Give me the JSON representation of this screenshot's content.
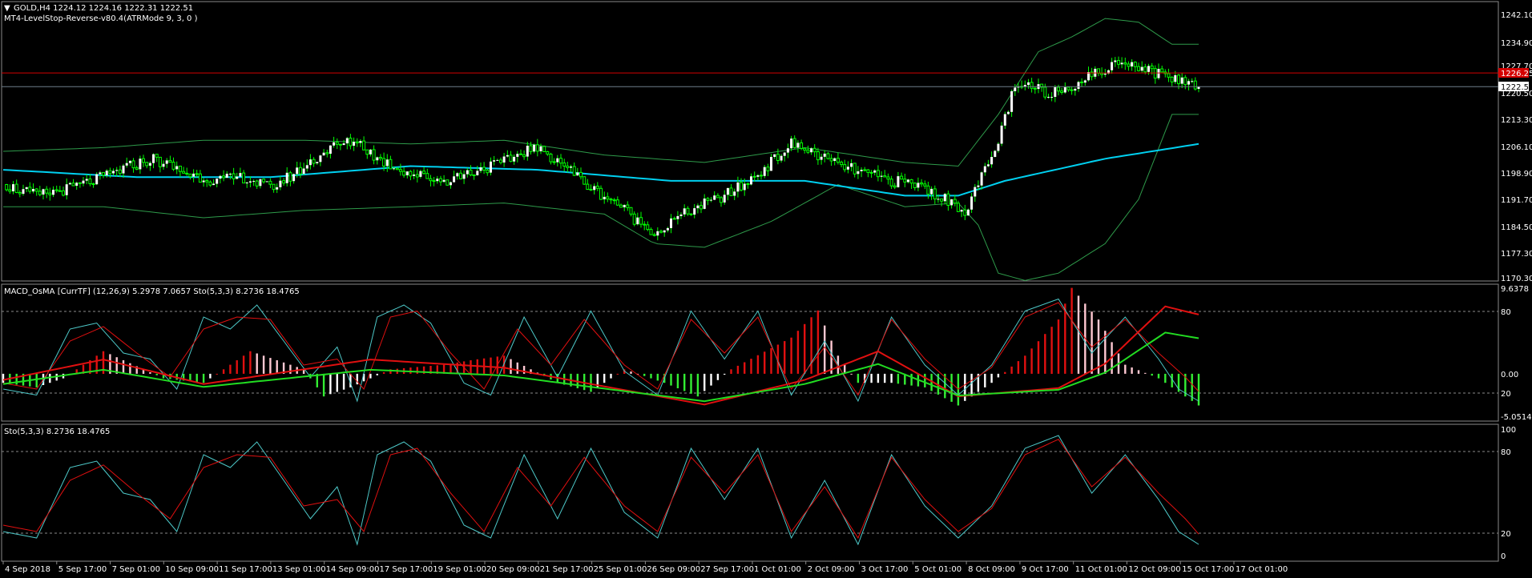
{
  "main_panel": {
    "symbol_line": "GOLD,H4  1224.12 1224.16 1222.31 1222.51",
    "indicator_line": "MT4-LevelStop-Reverse-v80.4(ATRMode 9, 3, 0 )",
    "price_ticks": [
      "1242.10",
      "1234.90",
      "1227.70",
      "1220.50",
      "1213.30",
      "1206.10",
      "1198.90",
      "1191.70",
      "1184.50",
      "1177.30",
      "1170.30"
    ],
    "current_price": "1222.51",
    "stop_level": "1226.25",
    "colors": {
      "bull": "#ffffff",
      "bear": "#000000",
      "wick": "#00ff00",
      "ma": "#00d0f0",
      "bands": "#2e9a4a",
      "stop_line": "#d40000",
      "price_line": "#6e7f8a"
    }
  },
  "macd_panel": {
    "title": "MACD_OsMA [CurrTF] (12,26,9) 5.2978 7.0657   Sto(5,3,3) 8.2736 18.4765",
    "ticks": [
      "9.6378",
      "80",
      "0.00",
      "20",
      "-5.0514"
    ]
  },
  "sto_panel": {
    "title": "Sto(5,3,3) 8.2736 18.4765",
    "ticks": [
      "100",
      "80",
      "20",
      "0"
    ]
  },
  "time_axis": [
    "4 Sep 2018",
    "5 Sep 17:00",
    "7 Sep 01:00",
    "10 Sep 09:00",
    "11 Sep 17:00",
    "13 Sep 01:00",
    "14 Sep 09:00",
    "17 Sep 17:00",
    "19 Sep 01:00",
    "20 Sep 09:00",
    "21 Sep 17:00",
    "25 Sep 01:00",
    "26 Sep 09:00",
    "27 Sep 17:00",
    "1 Oct 01:00",
    "2 Oct 09:00",
    "3 Oct 17:00",
    "5 Oct 01:00",
    "8 Oct 09:00",
    "9 Oct 17:00",
    "11 Oct 01:00",
    "12 Oct 09:00",
    "15 Oct 17:00",
    "17 Oct 01:00"
  ],
  "chart_data": [
    {
      "type": "candlestick",
      "symbol": "GOLD",
      "timeframe": "H4",
      "ylim": [
        1170.3,
        1242.1
      ],
      "close_path": [
        [
          0,
          1196
        ],
        [
          10,
          1193
        ],
        [
          20,
          1195
        ],
        [
          30,
          1198
        ],
        [
          38,
          1201
        ],
        [
          45,
          1203
        ],
        [
          55,
          1199
        ],
        [
          64,
          1197
        ],
        [
          72,
          1198
        ],
        [
          80,
          1195
        ],
        [
          89,
          1200
        ],
        [
          98,
          1206
        ],
        [
          106,
          1208
        ],
        [
          112,
          1203
        ],
        [
          122,
          1199
        ],
        [
          132,
          1197
        ],
        [
          142,
          1200
        ],
        [
          150,
          1202
        ],
        [
          158,
          1206
        ],
        [
          166,
          1203
        ],
        [
          176,
          1195
        ],
        [
          184,
          1191
        ],
        [
          190,
          1186
        ],
        [
          196,
          1183
        ],
        [
          202,
          1187
        ],
        [
          208,
          1190
        ],
        [
          214,
          1192
        ],
        [
          222,
          1196
        ],
        [
          230,
          1202
        ],
        [
          236,
          1207
        ],
        [
          242,
          1205
        ],
        [
          248,
          1202
        ],
        [
          258,
          1199
        ],
        [
          266,
          1197
        ],
        [
          274,
          1196
        ],
        [
          282,
          1192
        ],
        [
          288,
          1189
        ],
        [
          292,
          1196
        ],
        [
          297,
          1205
        ],
        [
          302,
          1220
        ],
        [
          306,
          1223
        ],
        [
          312,
          1221
        ],
        [
          318,
          1222
        ],
        [
          324,
          1225
        ],
        [
          330,
          1227
        ],
        [
          336,
          1230
        ],
        [
          340,
          1228
        ],
        [
          346,
          1226
        ],
        [
          350,
          1225
        ],
        [
          354,
          1224
        ],
        [
          358,
          1222.5
        ]
      ],
      "bands_upper_path": [
        [
          0,
          1205
        ],
        [
          30,
          1206
        ],
        [
          60,
          1208
        ],
        [
          90,
          1208
        ],
        [
          122,
          1207
        ],
        [
          150,
          1208
        ],
        [
          180,
          1204
        ],
        [
          210,
          1202
        ],
        [
          240,
          1206
        ],
        [
          270,
          1202
        ],
        [
          286,
          1201
        ],
        [
          298,
          1215
        ],
        [
          310,
          1232
        ],
        [
          320,
          1236
        ],
        [
          330,
          1241
        ],
        [
          340,
          1240
        ],
        [
          350,
          1234
        ],
        [
          358,
          1234
        ]
      ],
      "bands_lower_path": [
        [
          0,
          1190
        ],
        [
          30,
          1190
        ],
        [
          60,
          1187
        ],
        [
          90,
          1189
        ],
        [
          122,
          1190
        ],
        [
          150,
          1191
        ],
        [
          180,
          1188
        ],
        [
          195,
          1180
        ],
        [
          210,
          1179
        ],
        [
          230,
          1186
        ],
        [
          250,
          1196
        ],
        [
          270,
          1190
        ],
        [
          286,
          1191
        ],
        [
          292,
          1185
        ],
        [
          298,
          1172
        ],
        [
          306,
          1170
        ],
        [
          316,
          1172
        ],
        [
          330,
          1180
        ],
        [
          340,
          1192
        ],
        [
          350,
          1215
        ],
        [
          358,
          1215
        ]
      ],
      "ma_path": [
        [
          0,
          1200
        ],
        [
          40,
          1198
        ],
        [
          80,
          1198
        ],
        [
          122,
          1201
        ],
        [
          160,
          1200
        ],
        [
          200,
          1197
        ],
        [
          240,
          1197
        ],
        [
          270,
          1193
        ],
        [
          286,
          1193
        ],
        [
          300,
          1197
        ],
        [
          330,
          1203
        ],
        [
          358,
          1207
        ]
      ],
      "stop_level": 1226.25,
      "current_price": 1222.51
    },
    {
      "type": "bar",
      "name": "MACD_OsMA",
      "ylim": [
        -5.0514,
        9.6378
      ],
      "histogram_path": [
        [
          0,
          -1
        ],
        [
          10,
          -1.5
        ],
        [
          18,
          -0.5
        ],
        [
          24,
          1
        ],
        [
          30,
          2.5
        ],
        [
          36,
          1.5
        ],
        [
          42,
          0.5
        ],
        [
          48,
          -0.5
        ],
        [
          60,
          -1
        ],
        [
          66,
          0.5
        ],
        [
          74,
          2.5
        ],
        [
          82,
          1.5
        ],
        [
          90,
          0.5
        ],
        [
          96,
          -2.5
        ],
        [
          104,
          -1.5
        ],
        [
          116,
          0.5
        ],
        [
          132,
          1
        ],
        [
          140,
          1.5
        ],
        [
          150,
          2
        ],
        [
          158,
          0.5
        ],
        [
          166,
          -1
        ],
        [
          176,
          -2
        ],
        [
          186,
          0.5
        ],
        [
          198,
          -1
        ],
        [
          208,
          -2.5
        ],
        [
          218,
          0.5
        ],
        [
          236,
          4
        ],
        [
          244,
          7
        ],
        [
          250,
          2
        ],
        [
          256,
          -1
        ],
        [
          266,
          -1
        ],
        [
          276,
          -1.5
        ],
        [
          286,
          -3.5
        ],
        [
          296,
          -1
        ],
        [
          306,
          2
        ],
        [
          316,
          6
        ],
        [
          320,
          9.5
        ],
        [
          328,
          6
        ],
        [
          336,
          1
        ],
        [
          346,
          -0.5
        ],
        [
          352,
          -2
        ],
        [
          358,
          -3.5
        ]
      ],
      "signal_path": [
        [
          0,
          -1
        ],
        [
          30,
          1.5
        ],
        [
          60,
          -1.5
        ],
        [
          110,
          1.5
        ],
        [
          150,
          0.5
        ],
        [
          176,
          -1.5
        ],
        [
          210,
          -4
        ],
        [
          240,
          -1
        ],
        [
          262,
          2.5
        ],
        [
          286,
          -3
        ],
        [
          316,
          -2
        ],
        [
          330,
          1
        ],
        [
          348,
          8
        ],
        [
          358,
          7
        ]
      ]
    },
    {
      "type": "line",
      "name": "Sto(5,3,3)",
      "ylim": [
        0,
        100
      ],
      "main_path": [
        [
          0,
          20
        ],
        [
          10,
          15
        ],
        [
          20,
          70
        ],
        [
          28,
          75
        ],
        [
          36,
          50
        ],
        [
          44,
          45
        ],
        [
          52,
          20
        ],
        [
          60,
          80
        ],
        [
          68,
          70
        ],
        [
          76,
          90
        ],
        [
          84,
          60
        ],
        [
          92,
          30
        ],
        [
          100,
          55
        ],
        [
          106,
          10
        ],
        [
          112,
          80
        ],
        [
          120,
          90
        ],
        [
          128,
          75
        ],
        [
          138,
          25
        ],
        [
          146,
          15
        ],
        [
          156,
          80
        ],
        [
          166,
          30
        ],
        [
          176,
          85
        ],
        [
          186,
          35
        ],
        [
          196,
          15
        ],
        [
          206,
          85
        ],
        [
          216,
          45
        ],
        [
          226,
          85
        ],
        [
          236,
          15
        ],
        [
          246,
          60
        ],
        [
          256,
          10
        ],
        [
          266,
          80
        ],
        [
          276,
          40
        ],
        [
          286,
          15
        ],
        [
          296,
          40
        ],
        [
          306,
          85
        ],
        [
          316,
          95
        ],
        [
          326,
          50
        ],
        [
          336,
          80
        ],
        [
          346,
          45
        ],
        [
          352,
          20
        ],
        [
          358,
          10
        ]
      ],
      "signal_path": [
        [
          0,
          25
        ],
        [
          10,
          20
        ],
        [
          20,
          60
        ],
        [
          30,
          72
        ],
        [
          40,
          50
        ],
        [
          50,
          30
        ],
        [
          60,
          70
        ],
        [
          70,
          80
        ],
        [
          80,
          78
        ],
        [
          90,
          40
        ],
        [
          100,
          45
        ],
        [
          108,
          20
        ],
        [
          116,
          80
        ],
        [
          124,
          85
        ],
        [
          134,
          50
        ],
        [
          144,
          20
        ],
        [
          154,
          70
        ],
        [
          164,
          40
        ],
        [
          174,
          78
        ],
        [
          186,
          40
        ],
        [
          196,
          20
        ],
        [
          206,
          78
        ],
        [
          216,
          50
        ],
        [
          226,
          80
        ],
        [
          236,
          20
        ],
        [
          246,
          55
        ],
        [
          256,
          15
        ],
        [
          266,
          78
        ],
        [
          276,
          45
        ],
        [
          286,
          20
        ],
        [
          296,
          38
        ],
        [
          306,
          80
        ],
        [
          316,
          92
        ],
        [
          326,
          55
        ],
        [
          336,
          78
        ],
        [
          346,
          50
        ],
        [
          354,
          30
        ],
        [
          358,
          18
        ]
      ]
    }
  ]
}
